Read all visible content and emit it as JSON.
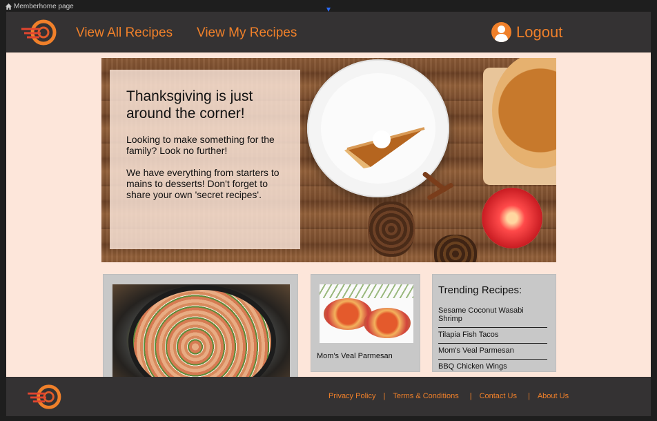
{
  "window": {
    "breadcrumb": "Memberhome page"
  },
  "header": {
    "nav": {
      "view_all": "View All Recipes",
      "view_mine": "View My Recipes"
    },
    "logout_label": "Logout"
  },
  "hero": {
    "headline": "Thanksgiving is just around the corner!",
    "paragraph_1": "Looking to make something for the family? Look no further!",
    "paragraph_2": "We have everything from starters to mains to desserts! Don't forget to share your own 'secret recipes'."
  },
  "featured": {
    "parm_caption": "Mom's Veal Parmesan"
  },
  "trending": {
    "title": "Trending Recipes:",
    "items": [
      "Sesame Coconut Wasabi Shrimp",
      "Tilapia Fish Tacos",
      "Mom's Veal Parmesan",
      "BBQ Chicken Wings"
    ]
  },
  "footer": {
    "privacy": "Privacy Policy",
    "terms": "Terms & Conditions",
    "contact": "Contact Us",
    "about": "About Us",
    "separator": "|"
  },
  "colors": {
    "accent": "#f0802a",
    "header_bg": "#343233",
    "page_bg": "#fde6da",
    "card_bg": "#c8c8c8"
  },
  "icons": {
    "breadcrumb": "home-icon",
    "logout": "user-icon",
    "brand": "logo-icon"
  }
}
